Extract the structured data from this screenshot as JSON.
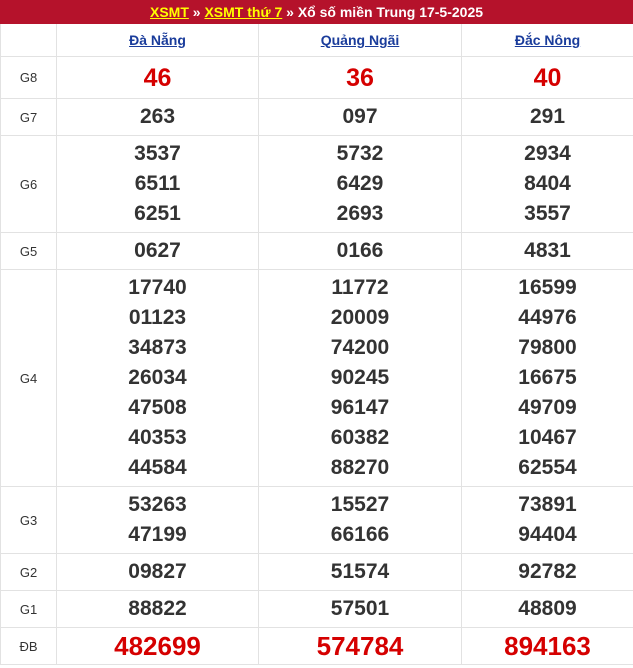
{
  "header": {
    "link1": "XSMT",
    "sep1": " » ",
    "link2": "XSMT thứ 7",
    "sep2": " » ",
    "title": "Xổ số miền Trung 17-5-2025"
  },
  "provinces": [
    "Đà Nẵng",
    "Quảng Ngãi",
    "Đắc Nông"
  ],
  "rows": {
    "g8": {
      "label": "G8",
      "values": [
        [
          "46"
        ],
        [
          "36"
        ],
        [
          "40"
        ]
      ]
    },
    "g7": {
      "label": "G7",
      "values": [
        [
          "263"
        ],
        [
          "097"
        ],
        [
          "291"
        ]
      ]
    },
    "g6": {
      "label": "G6",
      "values": [
        [
          "3537",
          "6511",
          "6251"
        ],
        [
          "5732",
          "6429",
          "2693"
        ],
        [
          "2934",
          "8404",
          "3557"
        ]
      ]
    },
    "g5": {
      "label": "G5",
      "values": [
        [
          "0627"
        ],
        [
          "0166"
        ],
        [
          "4831"
        ]
      ]
    },
    "g4": {
      "label": "G4",
      "values": [
        [
          "17740",
          "01123",
          "34873",
          "26034",
          "47508",
          "40353",
          "44584"
        ],
        [
          "11772",
          "20009",
          "74200",
          "90245",
          "96147",
          "60382",
          "88270"
        ],
        [
          "16599",
          "44976",
          "79800",
          "16675",
          "49709",
          "10467",
          "62554"
        ]
      ]
    },
    "g3": {
      "label": "G3",
      "values": [
        [
          "53263",
          "47199"
        ],
        [
          "15527",
          "66166"
        ],
        [
          "73891",
          "94404"
        ]
      ]
    },
    "g2": {
      "label": "G2",
      "values": [
        [
          "09827"
        ],
        [
          "51574"
        ],
        [
          "92782"
        ]
      ]
    },
    "g1": {
      "label": "G1",
      "values": [
        [
          "88822"
        ],
        [
          "57501"
        ],
        [
          "48809"
        ]
      ]
    },
    "db": {
      "label": "ĐB",
      "values": [
        [
          "482699"
        ],
        [
          "574784"
        ],
        [
          "894163"
        ]
      ]
    }
  },
  "colors": {
    "header_bg": "#b5122b",
    "header_link": "#ffff00",
    "prize_red": "#d50000",
    "province_link": "#1a3c9b"
  }
}
